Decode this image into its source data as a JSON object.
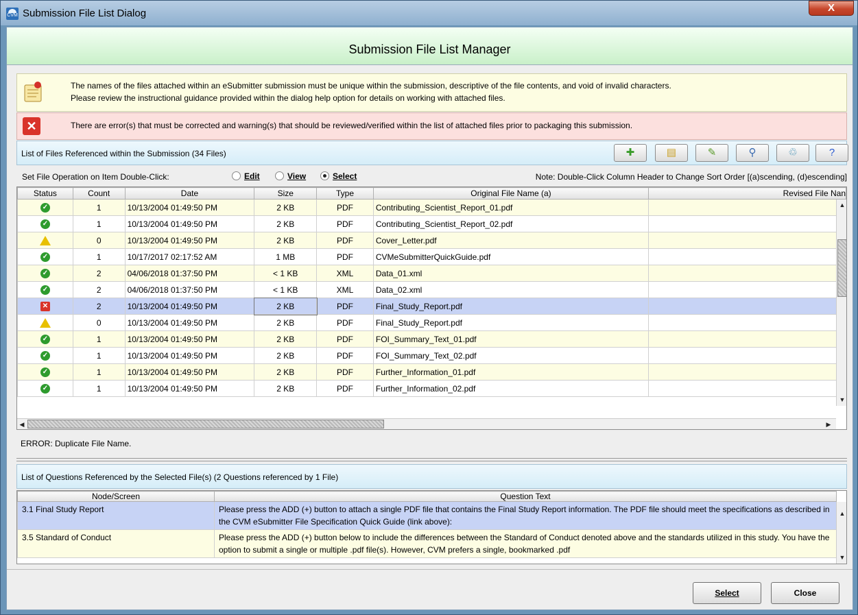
{
  "window": {
    "title": "Submission File List Dialog",
    "close_label": "X"
  },
  "header": {
    "title": "Submission File List Manager"
  },
  "info": {
    "line1": "The names of the files attached within an eSubmitter submission must be unique within the submission, descriptive of the file contents, and void of invalid characters.",
    "line2": "Please review the instructional guidance provided within the dialog help option for details on working with attached files."
  },
  "error_banner": {
    "text": "There are error(s) that must be corrected and warning(s) that should be reviewed/verified within the list of attached files prior to packaging this submission."
  },
  "files": {
    "heading": "List of Files Referenced within the Submission  (34 Files)",
    "toolbar": [
      {
        "icon": "add-icon",
        "glyph": "✚",
        "color": "#3a9b2a"
      },
      {
        "icon": "attach-icon",
        "glyph": "▤",
        "color": "#c9a12a"
      },
      {
        "icon": "edit-icon",
        "glyph": "✎",
        "color": "#5a9a2a"
      },
      {
        "icon": "view-icon",
        "glyph": "⚲",
        "color": "#3a6ab0"
      },
      {
        "icon": "remove-icon",
        "glyph": "♲",
        "color": "#3a8ab0"
      },
      {
        "icon": "help-icon",
        "glyph": "?",
        "color": "#2a5ad0"
      }
    ],
    "operation_label": "Set File Operation on Item Double-Click:",
    "options": {
      "edit": "Edit",
      "view": "View",
      "select": "Select",
      "selected": "select"
    },
    "note": "Note: Double-Click Column Header to Change Sort Order [(a)scending, (d)escending]",
    "columns": [
      "Status",
      "Count",
      "Date",
      "Size",
      "Type",
      "Original File Name (a)",
      "Revised File Nan"
    ],
    "rows": [
      {
        "status": "ok",
        "count": "1",
        "date": "10/13/2004 01:49:50 PM",
        "size": "2 KB",
        "type": "PDF",
        "name": "Contributing_Scientist_Report_01.pdf"
      },
      {
        "status": "ok",
        "count": "1",
        "date": "10/13/2004 01:49:50 PM",
        "size": "2 KB",
        "type": "PDF",
        "name": "Contributing_Scientist_Report_02.pdf"
      },
      {
        "status": "warn",
        "count": "0",
        "date": "10/13/2004 01:49:50 PM",
        "size": "2 KB",
        "type": "PDF",
        "name": "Cover_Letter.pdf"
      },
      {
        "status": "ok",
        "count": "1",
        "date": "10/17/2017 02:17:52 AM",
        "size": "1 MB",
        "type": "PDF",
        "name": "CVMeSubmitterQuickGuide.pdf"
      },
      {
        "status": "ok",
        "count": "2",
        "date": "04/06/2018 01:37:50 PM",
        "size": "< 1 KB",
        "type": "XML",
        "name": "Data_01.xml"
      },
      {
        "status": "ok",
        "count": "2",
        "date": "04/06/2018 01:37:50 PM",
        "size": "< 1 KB",
        "type": "XML",
        "name": "Data_02.xml"
      },
      {
        "status": "err",
        "count": "2",
        "date": "10/13/2004 01:49:50 PM",
        "size": "2 KB",
        "type": "PDF",
        "name": "Final_Study_Report.pdf"
      },
      {
        "status": "warn",
        "count": "0",
        "date": "10/13/2004 01:49:50 PM",
        "size": "2 KB",
        "type": "PDF",
        "name": "Final_Study_Report.pdf"
      },
      {
        "status": "ok",
        "count": "1",
        "date": "10/13/2004 01:49:50 PM",
        "size": "2 KB",
        "type": "PDF",
        "name": "FOI_Summary_Text_01.pdf"
      },
      {
        "status": "ok",
        "count": "1",
        "date": "10/13/2004 01:49:50 PM",
        "size": "2 KB",
        "type": "PDF",
        "name": "FOI_Summary_Text_02.pdf"
      },
      {
        "status": "ok",
        "count": "1",
        "date": "10/13/2004 01:49:50 PM",
        "size": "2 KB",
        "type": "PDF",
        "name": "Further_Information_01.pdf"
      },
      {
        "status": "ok",
        "count": "1",
        "date": "10/13/2004 01:49:50 PM",
        "size": "2 KB",
        "type": "PDF",
        "name": "Further_Information_02.pdf"
      }
    ],
    "selected_row": 6,
    "error_message": "ERROR: Duplicate File Name."
  },
  "questions": {
    "heading": "List of Questions Referenced by the Selected File(s)  (2 Questions referenced by 1 File)",
    "columns": [
      "Node/Screen",
      "Question Text"
    ],
    "rows": [
      {
        "node": "3.1 Final Study Report",
        "text": "Please press the ADD (+) button to attach a single PDF file that contains the Final Study Report information. The PDF file should meet the specifications as described in the CVM eSubmitter File Specification Quick Guide (link above):"
      },
      {
        "node": "3.5 Standard of Conduct",
        "text": "Please press the ADD (+) button below to include the differences between the Standard of Conduct denoted above and the standards utilized in this study. You have the option to submit a single or multiple .pdf file(s). However, CVM prefers a single, bookmarked .pdf"
      }
    ]
  },
  "buttons": {
    "select": "Select",
    "close": "Close"
  }
}
